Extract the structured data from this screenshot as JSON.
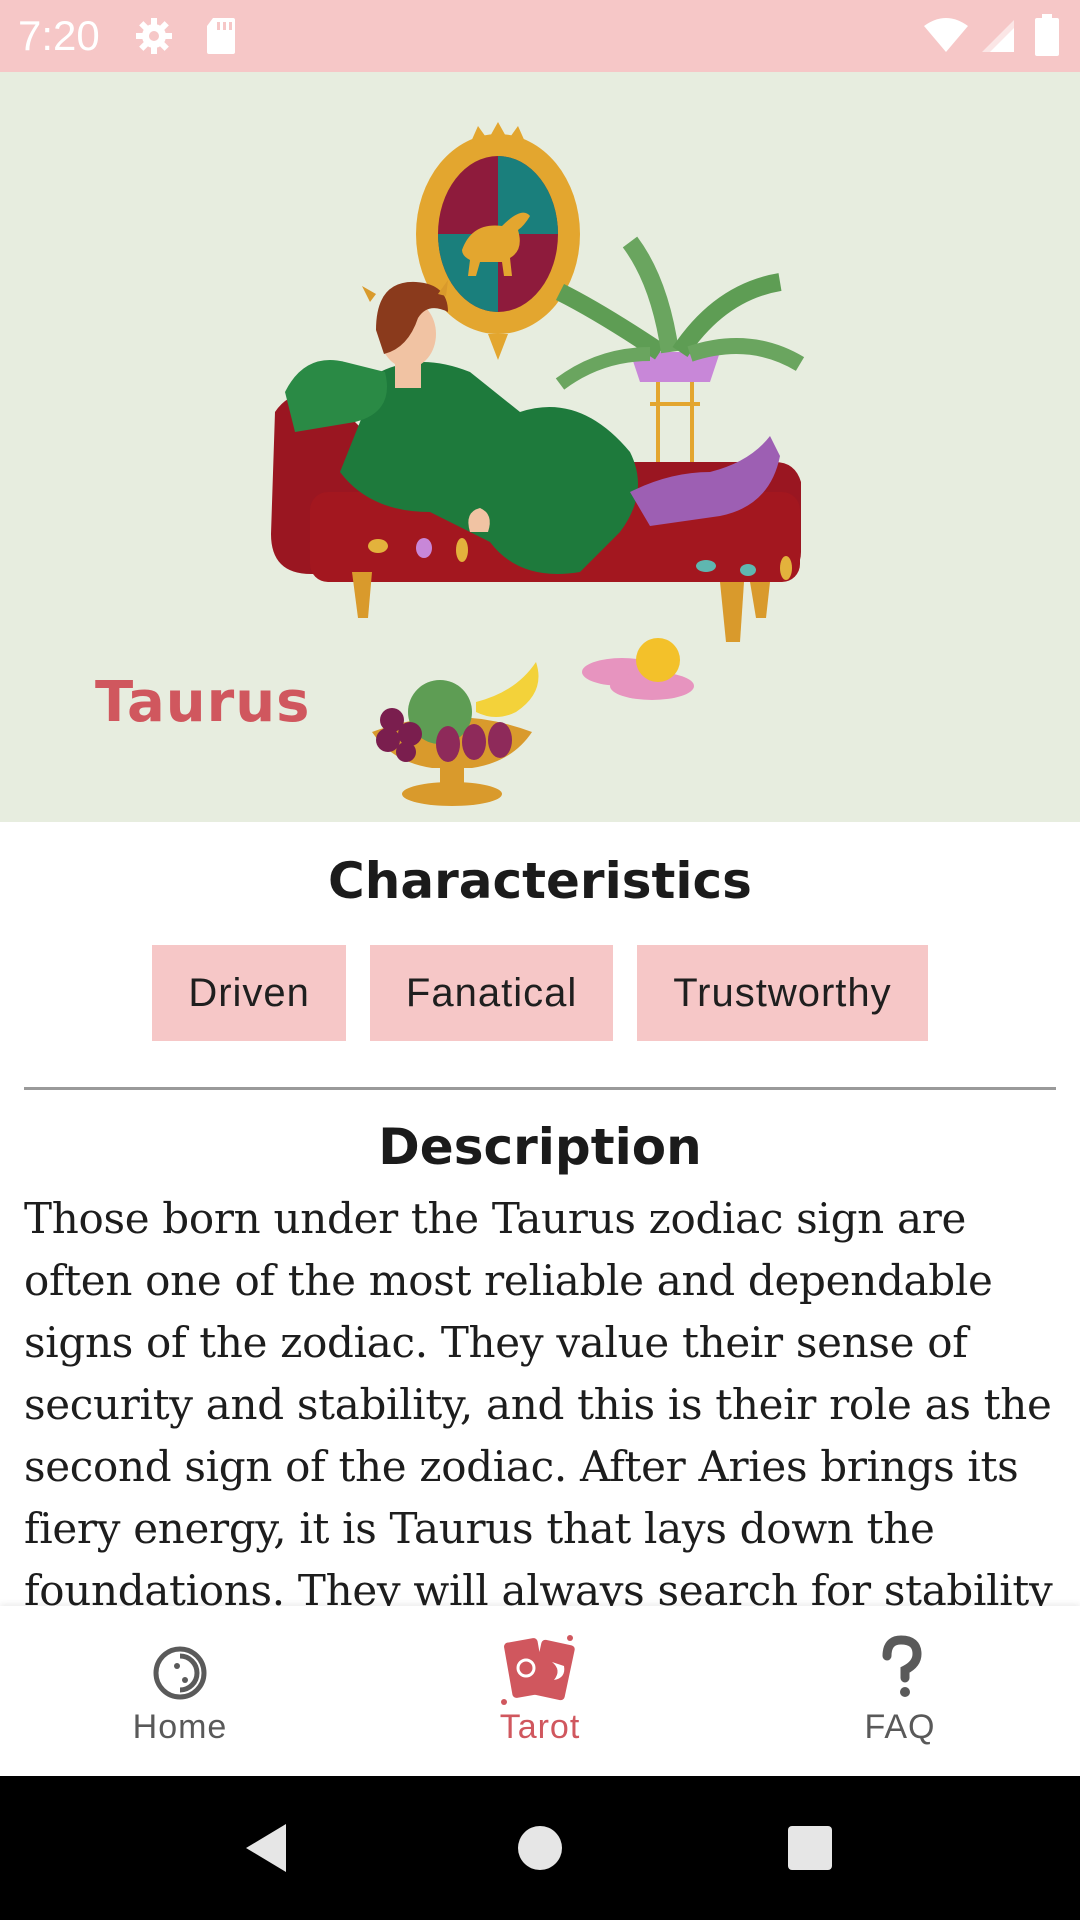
{
  "status_bar": {
    "time": "7:20",
    "icons": [
      "gear-icon",
      "sd-card-icon",
      "wifi-icon",
      "signal-icon",
      "battery-icon"
    ],
    "background": "#f6c7c7"
  },
  "hero": {
    "sign_name": "Taurus",
    "illustration": "woman-reclining-on-sofa-illustration",
    "background": "#e7eddf",
    "accent": "#d0575e"
  },
  "characteristics": {
    "title": "Characteristics",
    "traits": [
      "Driven",
      "Fanatical",
      "Trustworthy"
    ]
  },
  "description": {
    "title": "Description",
    "text": "Those born under the Taurus zodiac sign are often one of the most reliable and dependable signs of the zodiac. They value their sense of security and stability, and this is their role as the second sign of the zodiac. After Aries brings its fiery energy, it is Taurus that lays down the foundations. They will always search for stability in both their choices and"
  },
  "bottom_nav": {
    "items": [
      {
        "label": "Home",
        "icon": "home-icon",
        "active": false
      },
      {
        "label": "Tarot",
        "icon": "tarot-cards-icon",
        "active": true
      },
      {
        "label": "FAQ",
        "icon": "question-mark-icon",
        "active": false
      }
    ],
    "active_color": "#d0575e",
    "inactive_color": "#595959"
  },
  "system_nav": {
    "buttons": [
      "back-icon",
      "home-circle-icon",
      "recents-icon"
    ]
  }
}
